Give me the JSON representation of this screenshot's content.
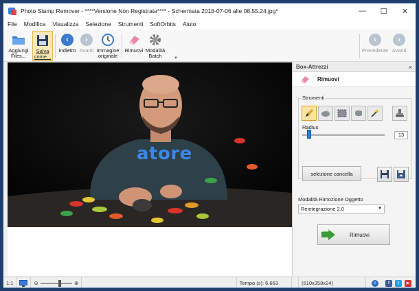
{
  "window": {
    "title": "Photo Stamp Remover - ****Versione Non Registrata**** - Schermata 2018-07-06 alle 08.55.24.jpg*",
    "controls": {
      "minimize": "—",
      "maximize": "☐",
      "close": "✕"
    }
  },
  "menu": [
    "File",
    "Modifica",
    "Visualizza",
    "Selezione",
    "Strumenti",
    "SoftOrbits",
    "Aiuto"
  ],
  "toolbar": {
    "add_files": "Aggiungi Files...",
    "save_as": "Salva come...",
    "back": "Indietro",
    "forward": "Avanti",
    "original": "Immagine originale",
    "remove": "Rimuovi",
    "batch": "Modalità Batch",
    "previous": "Precedente",
    "next": "Avanti"
  },
  "image": {
    "stamp_text": "atore"
  },
  "panel": {
    "title": "Box-Attrezzi",
    "close": "×",
    "tool_name": "Rimuovi",
    "tools_label": "Strumenti",
    "radius_label": "Radius",
    "radius_value": "13",
    "radius_fraction": 0.08,
    "clear_selection": "selezione cancella",
    "mode_label": "Modalità Rimozione Oggetto",
    "mode_value": "Reintegrazione 2.0",
    "remove_button": "Rimuovi"
  },
  "status": {
    "zoom_label": "1:1",
    "time": "Tempo (s): 6.663",
    "size": "(610x358x24)"
  },
  "colors": {
    "accent": "#3a7bd0",
    "selected": "#fbe3a2",
    "stamp": "#3d86e8"
  }
}
